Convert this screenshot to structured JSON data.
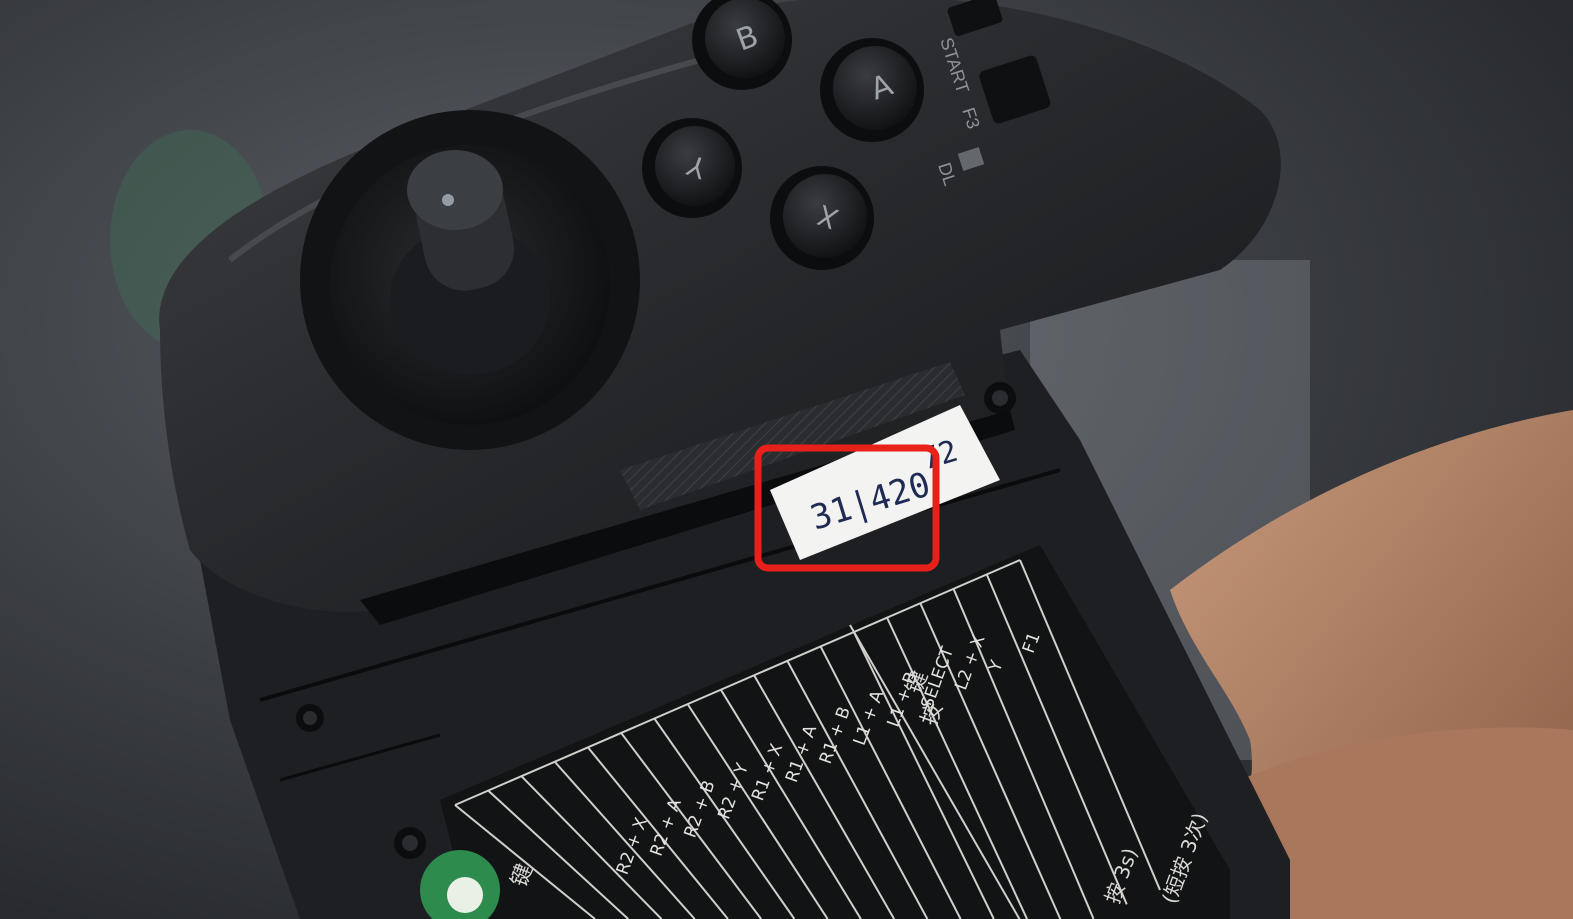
{
  "photo": {
    "description_free": true,
    "controller": {
      "buttons": [
        {
          "letter": "B"
        },
        {
          "letter": "A"
        },
        {
          "letter": "Y"
        },
        {
          "letter": "X"
        }
      ],
      "side_labels": {
        "start": "START",
        "f3": "F3",
        "dl": "DL"
      }
    },
    "sticker": {
      "serial": "31|420",
      "suffix": "72"
    },
    "highlight": {
      "color": "#e8201a"
    },
    "cheat_sheet": {
      "column_labels": [
        "R2 + X",
        "R2 + A",
        "R2 + B",
        "R2 + Y",
        "R1 + X",
        "R1 + A",
        "R1 + B",
        "L1 + A",
        "L1 + B",
        "SELECT",
        "L2 + X",
        "Y",
        "F1"
      ],
      "chinese_key": "键",
      "chinese_press": "按",
      "note_short": "(短按 3次)",
      "note_long": "按 3s)"
    }
  }
}
